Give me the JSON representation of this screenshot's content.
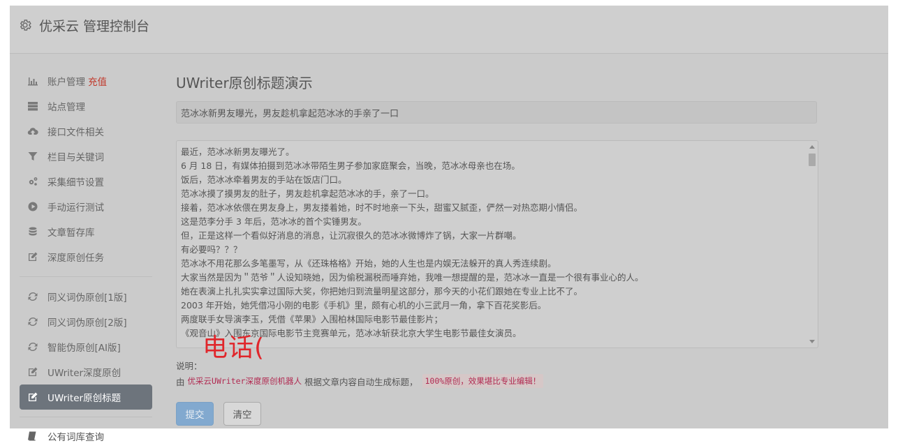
{
  "header": {
    "brand": "优采云 管理控制台"
  },
  "sidebar": {
    "group1": [
      {
        "label": "账户管理",
        "accent": "充值",
        "icon": "bar-chart-icon"
      },
      {
        "label": "站点管理",
        "icon": "server-icon"
      },
      {
        "label": "接口文件相关",
        "icon": "cloud-upload-icon"
      },
      {
        "label": "栏目与关键词",
        "icon": "filter-icon"
      },
      {
        "label": "采集细节设置",
        "icon": "cogs-icon"
      },
      {
        "label": "手动运行测试",
        "icon": "play-circle-icon"
      },
      {
        "label": "文章暂存库",
        "icon": "database-icon"
      },
      {
        "label": "深度原创任务",
        "icon": "edit-icon"
      }
    ],
    "group2": [
      {
        "label": "同义词伪原创[1版]",
        "icon": "refresh-icon"
      },
      {
        "label": "同义词伪原创[2版]",
        "icon": "refresh-icon"
      },
      {
        "label": "智能伪原创[AI版]",
        "icon": "refresh-icon"
      },
      {
        "label": "UWriter深度原创",
        "icon": "edit-icon"
      },
      {
        "label": "UWriter原创标题",
        "icon": "edit-icon",
        "active": true
      }
    ],
    "bottom": {
      "label": "公有词库查询",
      "icon": "book-icon"
    }
  },
  "main": {
    "heading": "UWriter原创标题演示",
    "title_value": "范冰冰新男友曝光，男友趁机拿起范冰冰的手亲了一口",
    "content_lines": [
      "最近，范冰冰新男友曝光了。",
      "6 月 18 日，有媒体拍摄到范冰冰带陌生男子参加家庭聚会，当晚，范冰冰母亲也在场。",
      "饭后，范冰冰牵着男友的手站在饭店门口。",
      "范冰冰摸了摸男友的肚子，男友趁机拿起范冰冰的手，亲了一口。",
      "接着，范冰冰依偎在男友身上，男友搂着她，时不时地亲一下头，甜蜜又腻歪，俨然一对热恋期小情侣。",
      "这是范李分手 3 年后，范冰冰的首个实锤男友。",
      "但，正是这样一个看似好消息的消息，让沉寂很久的范冰冰微博炸了锅，大家一片群嘲。",
      "有必要吗？？？",
      "范冰冰不用花那么多笔墨写，从《还珠格格》开始，她的人生也是内娱无法躲开的真人秀连续剧。",
      "大家当然是因为＂范爷＂人设知晓她，因为偷税漏税而唾弃她，我唯一想提醒的是，范冰冰一直是一个很有事业心的人。",
      "她在表演上扎扎实实拿过国际大奖，你把她归到流量明星这部分，那今天的小花们跟她在专业上比不了。",
      "2003 年开始，她凭借冯小刚的电影《手机》里，颇有心机的小三武月一角，拿下百花奖影后。",
      "两度联手女导演李玉，凭借《苹果》入围柏林国际电影节最佳影片；",
      "《观音山》入围东京国际电影节主竞赛单元，范冰冰斩获北京大学生电影节最佳女演员。"
    ],
    "watermark": "电话(",
    "explain_label": "说明：",
    "explain_prefix": "由",
    "explain_link": "优采云UWriter深度原创机器人",
    "explain_mid": "根据文章内容自动生成标题，",
    "explain_highlight": "100%原创，效果堪比专业编辑！",
    "submit_label": "提交",
    "clear_label": "清空"
  }
}
